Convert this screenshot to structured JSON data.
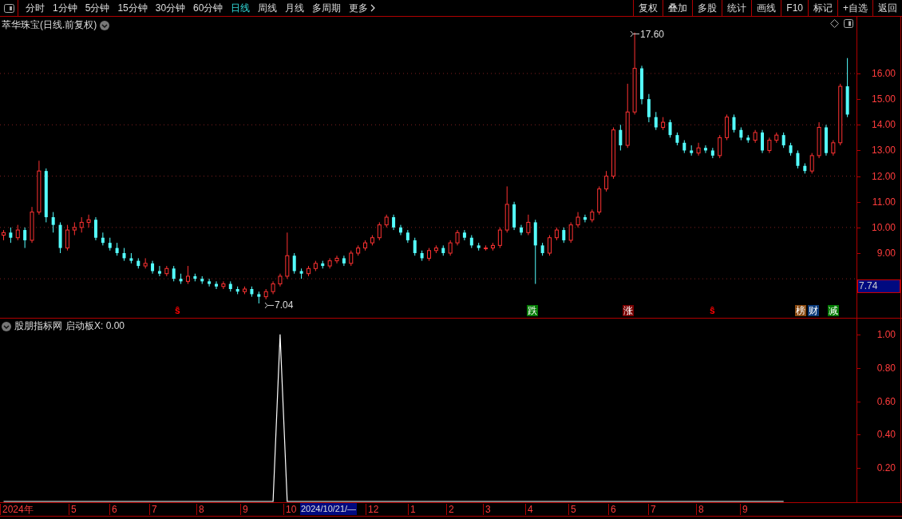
{
  "toolbar": {
    "periods": [
      {
        "label": "分时",
        "selected": false
      },
      {
        "label": "1分钟",
        "selected": false
      },
      {
        "label": "5分钟",
        "selected": false
      },
      {
        "label": "15分钟",
        "selected": false
      },
      {
        "label": "30分钟",
        "selected": false
      },
      {
        "label": "60分钟",
        "selected": false
      },
      {
        "label": "日线",
        "selected": true
      },
      {
        "label": "周线",
        "selected": false
      },
      {
        "label": "月线",
        "selected": false
      },
      {
        "label": "多周期",
        "selected": false
      },
      {
        "label": "更多",
        "selected": false
      }
    ],
    "actions": [
      "复权",
      "叠加",
      "多股",
      "统计",
      "画线",
      "F10",
      "标记",
      "+自选",
      "返回"
    ]
  },
  "price_chart": {
    "title": "萃华珠宝(日线.前复权)",
    "high_label": "17.60",
    "low_label": "7.04",
    "chart_data": {
      "type": "candlestick",
      "grid": true,
      "ylim": [
        6.48,
        18.21
      ],
      "yticks": [
        {
          "value": 16,
          "label": "16.00"
        },
        {
          "value": 15,
          "label": "15.00"
        },
        {
          "value": 14,
          "label": "14.00"
        },
        {
          "value": 13,
          "label": "13.00"
        },
        {
          "value": 12,
          "label": "12.00"
        },
        {
          "value": 11,
          "label": "11.00"
        },
        {
          "value": 10,
          "label": "10.00"
        },
        {
          "value": 9,
          "label": "9.00"
        }
      ],
      "ohlc": [
        [
          9.7,
          9.9,
          9.5,
          9.8
        ],
        [
          9.8,
          10.0,
          9.4,
          9.6
        ],
        [
          9.6,
          10.1,
          9.5,
          9.9
        ],
        [
          9.9,
          10.0,
          9.2,
          9.5
        ],
        [
          9.5,
          10.8,
          9.4,
          10.6
        ],
        [
          10.6,
          12.6,
          10.5,
          12.2
        ],
        [
          12.2,
          12.3,
          10.2,
          10.4
        ],
        [
          10.4,
          10.6,
          9.8,
          10.1
        ],
        [
          10.1,
          10.2,
          9.0,
          9.2
        ],
        [
          9.2,
          10.1,
          9.1,
          9.9
        ],
        [
          9.9,
          10.2,
          9.7,
          10.0
        ],
        [
          10.0,
          10.4,
          9.8,
          10.2
        ],
        [
          10.2,
          10.5,
          10.0,
          10.3
        ],
        [
          10.3,
          10.4,
          9.5,
          9.6
        ],
        [
          9.6,
          9.8,
          9.3,
          9.4
        ],
        [
          9.4,
          9.6,
          9.1,
          9.2
        ],
        [
          9.2,
          9.4,
          8.9,
          9.0
        ],
        [
          9.0,
          9.2,
          8.7,
          8.8
        ],
        [
          8.8,
          9.0,
          8.6,
          8.7
        ],
        [
          8.7,
          8.8,
          8.4,
          8.5
        ],
        [
          8.5,
          8.8,
          8.4,
          8.6
        ],
        [
          8.6,
          8.7,
          8.2,
          8.3
        ],
        [
          8.3,
          8.5,
          8.1,
          8.2
        ],
        [
          8.2,
          8.5,
          8.1,
          8.4
        ],
        [
          8.4,
          8.5,
          7.9,
          8.0
        ],
        [
          8.0,
          8.2,
          7.8,
          7.9
        ],
        [
          7.9,
          8.5,
          7.8,
          8.1
        ],
        [
          8.1,
          8.2,
          7.9,
          8.0
        ],
        [
          8.0,
          8.1,
          7.8,
          7.9
        ],
        [
          7.9,
          8.0,
          7.7,
          7.8
        ],
        [
          7.8,
          7.9,
          7.6,
          7.7
        ],
        [
          7.7,
          7.9,
          7.6,
          7.8
        ],
        [
          7.8,
          7.9,
          7.5,
          7.6
        ],
        [
          7.6,
          7.7,
          7.4,
          7.5
        ],
        [
          7.5,
          7.7,
          7.4,
          7.6
        ],
        [
          7.6,
          7.7,
          7.3,
          7.4
        ],
        [
          7.4,
          7.5,
          7.04,
          7.3
        ],
        [
          7.3,
          7.6,
          7.2,
          7.5
        ],
        [
          7.5,
          7.9,
          7.4,
          7.8
        ],
        [
          7.8,
          8.2,
          7.7,
          8.1
        ],
        [
          8.1,
          9.8,
          8.0,
          8.9
        ],
        [
          8.9,
          9.0,
          8.2,
          8.3
        ],
        [
          8.3,
          8.4,
          8.0,
          8.2
        ],
        [
          8.2,
          8.5,
          8.1,
          8.4
        ],
        [
          8.4,
          8.7,
          8.3,
          8.6
        ],
        [
          8.6,
          8.7,
          8.4,
          8.5
        ],
        [
          8.5,
          8.8,
          8.4,
          8.7
        ],
        [
          8.7,
          8.9,
          8.6,
          8.8
        ],
        [
          8.8,
          8.9,
          8.5,
          8.6
        ],
        [
          8.6,
          9.1,
          8.5,
          9.0
        ],
        [
          9.0,
          9.3,
          8.9,
          9.2
        ],
        [
          9.2,
          9.5,
          9.1,
          9.4
        ],
        [
          9.4,
          9.7,
          9.3,
          9.6
        ],
        [
          9.6,
          10.2,
          9.5,
          10.1
        ],
        [
          10.1,
          10.5,
          10.0,
          10.4
        ],
        [
          10.4,
          10.5,
          9.9,
          10.0
        ],
        [
          10.0,
          10.1,
          9.7,
          9.8
        ],
        [
          9.8,
          9.9,
          9.4,
          9.5
        ],
        [
          9.5,
          9.6,
          8.9,
          9.0
        ],
        [
          9.0,
          9.1,
          8.7,
          8.8
        ],
        [
          8.8,
          9.2,
          8.7,
          9.1
        ],
        [
          9.1,
          9.3,
          9.0,
          9.2
        ],
        [
          9.2,
          9.3,
          8.9,
          9.0
        ],
        [
          9.0,
          9.5,
          8.9,
          9.4
        ],
        [
          9.4,
          9.9,
          9.3,
          9.8
        ],
        [
          9.8,
          9.9,
          9.5,
          9.6
        ],
        [
          9.6,
          9.7,
          9.2,
          9.3
        ],
        [
          9.3,
          9.4,
          9.1,
          9.2
        ],
        [
          9.2,
          9.3,
          9.1,
          9.2
        ],
        [
          9.2,
          9.4,
          9.1,
          9.3
        ],
        [
          9.3,
          10.0,
          9.2,
          9.9
        ],
        [
          9.9,
          11.6,
          9.8,
          10.9
        ],
        [
          10.9,
          11.0,
          9.9,
          10.0
        ],
        [
          10.0,
          10.1,
          9.7,
          9.8
        ],
        [
          9.8,
          10.5,
          9.7,
          10.2
        ],
        [
          10.2,
          10.3,
          7.8,
          9.3
        ],
        [
          9.3,
          9.4,
          8.9,
          9.0
        ],
        [
          9.0,
          9.7,
          8.9,
          9.6
        ],
        [
          9.6,
          10.0,
          9.5,
          9.9
        ],
        [
          9.9,
          10.0,
          9.4,
          9.5
        ],
        [
          9.5,
          10.2,
          9.4,
          10.1
        ],
        [
          10.1,
          10.6,
          10.0,
          10.4
        ],
        [
          10.4,
          10.5,
          10.2,
          10.3
        ],
        [
          10.3,
          10.7,
          10.2,
          10.6
        ],
        [
          10.6,
          11.6,
          10.5,
          11.5
        ],
        [
          11.5,
          12.2,
          11.4,
          12.0
        ],
        [
          12.0,
          13.9,
          11.9,
          13.8
        ],
        [
          13.8,
          14.0,
          13.0,
          13.2
        ],
        [
          13.2,
          15.6,
          13.1,
          14.5
        ],
        [
          14.5,
          17.6,
          14.4,
          16.2
        ],
        [
          16.2,
          16.3,
          14.8,
          15.0
        ],
        [
          15.0,
          15.2,
          14.1,
          14.3
        ],
        [
          14.3,
          14.5,
          13.8,
          13.9
        ],
        [
          13.9,
          14.3,
          13.8,
          14.1
        ],
        [
          14.1,
          14.2,
          13.5,
          13.6
        ],
        [
          13.6,
          13.7,
          13.2,
          13.3
        ],
        [
          13.3,
          13.4,
          12.9,
          13.0
        ],
        [
          13.0,
          13.2,
          12.8,
          12.9
        ],
        [
          12.9,
          13.3,
          12.8,
          13.1
        ],
        [
          13.1,
          13.2,
          12.9,
          13.0
        ],
        [
          13.0,
          13.1,
          12.7,
          12.8
        ],
        [
          12.8,
          13.6,
          12.7,
          13.5
        ],
        [
          13.5,
          14.4,
          13.4,
          14.3
        ],
        [
          14.3,
          14.4,
          13.7,
          13.8
        ],
        [
          13.8,
          13.9,
          13.4,
          13.5
        ],
        [
          13.5,
          13.6,
          13.3,
          13.4
        ],
        [
          13.4,
          13.8,
          13.3,
          13.7
        ],
        [
          13.7,
          13.8,
          12.9,
          13.0
        ],
        [
          13.0,
          13.5,
          12.9,
          13.4
        ],
        [
          13.4,
          13.7,
          13.3,
          13.6
        ],
        [
          13.6,
          13.7,
          13.1,
          13.2
        ],
        [
          13.2,
          13.3,
          12.8,
          12.9
        ],
        [
          12.9,
          13.0,
          12.3,
          12.4
        ],
        [
          12.4,
          12.5,
          12.1,
          12.2
        ],
        [
          12.2,
          12.9,
          12.1,
          12.8
        ],
        [
          12.8,
          14.1,
          12.7,
          13.9
        ],
        [
          13.9,
          14.0,
          12.8,
          12.9
        ],
        [
          12.9,
          13.4,
          12.8,
          13.3
        ],
        [
          13.3,
          15.6,
          13.2,
          15.5
        ],
        [
          15.5,
          16.6,
          14.3,
          14.4
        ]
      ]
    },
    "current_price": "7.74",
    "markers": [
      {
        "text": "ŝ",
        "kind": "signal",
        "color": "#ff0000"
      },
      {
        "text": "跌",
        "kind": "tag",
        "color": "#007a00"
      },
      {
        "text": "涨",
        "kind": "tag",
        "color": "#7a0000"
      },
      {
        "text": "ŝ",
        "kind": "signal",
        "color": "#ff0000"
      },
      {
        "text": "榜",
        "kind": "tag",
        "color": "#8a4a10"
      },
      {
        "text": "财",
        "kind": "tag",
        "color": "#0a3a7a"
      },
      {
        "text": "减",
        "kind": "tag",
        "color": "#007a00"
      }
    ]
  },
  "indicator": {
    "name": "股朋指标网",
    "reading": "启动板X: 0.00",
    "chart_data": {
      "type": "line",
      "ylim": [
        0,
        1.095
      ],
      "yticks": [
        {
          "value": 1,
          "label": "1.00"
        },
        {
          "value": 0.8,
          "label": "0.80"
        },
        {
          "value": 0.6,
          "label": "0.60"
        },
        {
          "value": 0.4,
          "label": "0.40"
        },
        {
          "value": 0.2,
          "label": "0.20"
        }
      ],
      "series": [
        {
          "color": "#ffffff",
          "values": [
            0,
            0,
            0,
            0,
            0,
            0,
            0,
            0,
            0,
            0,
            0,
            0,
            0,
            0,
            0,
            0,
            0,
            0,
            0,
            0,
            0,
            0,
            0,
            0,
            0,
            0,
            0,
            0,
            0,
            0,
            0,
            0,
            0,
            0,
            0,
            0,
            0,
            0,
            0,
            1,
            0,
            0,
            0,
            0,
            0,
            0,
            0,
            0,
            0,
            0,
            0,
            0,
            0,
            0,
            0,
            0,
            0,
            0,
            0,
            0,
            0,
            0,
            0,
            0,
            0,
            0,
            0,
            0,
            0,
            0,
            0,
            0,
            0,
            0,
            0,
            0,
            0,
            0,
            0,
            0,
            0,
            0,
            0,
            0,
            0,
            0,
            0,
            0,
            0,
            0,
            0,
            0,
            0,
            0,
            0,
            0,
            0,
            0,
            0,
            0,
            0,
            0,
            0,
            0,
            0,
            0,
            0,
            0,
            0,
            0,
            0,
            null,
            null,
            null,
            null,
            null,
            null,
            null,
            null,
            null
          ]
        }
      ]
    }
  },
  "date_axis": {
    "labels": [
      "2024年",
      "5",
      "6",
      "7",
      "8",
      "9",
      "10",
      "12",
      "1",
      "2",
      "3",
      "4",
      "5",
      "6",
      "7",
      "8",
      "9"
    ],
    "cursor_date": "2024/10/21/—"
  }
}
